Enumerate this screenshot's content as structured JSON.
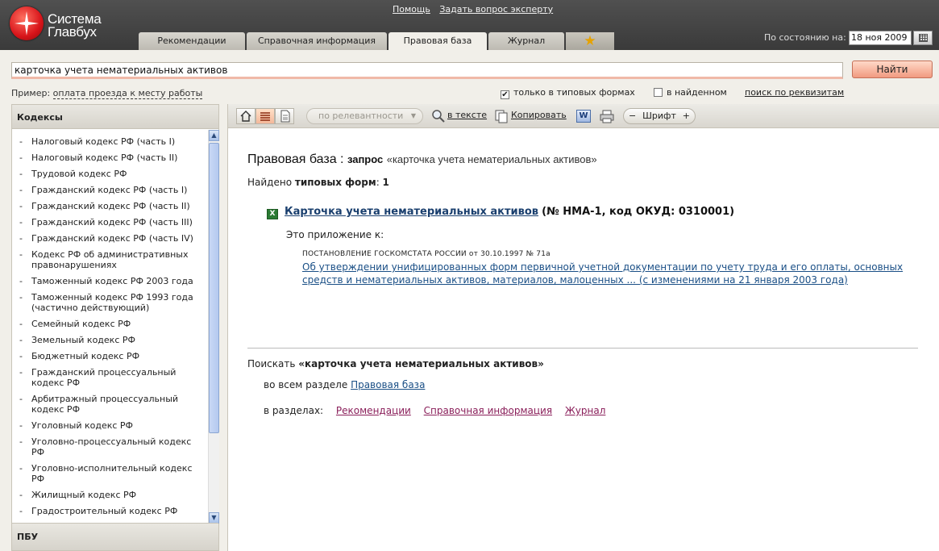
{
  "brand": {
    "line1": "Система",
    "line2": "Главбух"
  },
  "top_links": {
    "help": "Помощь",
    "ask_expert": "Задать вопрос эксперту"
  },
  "tabs": [
    {
      "label": "Рекомендации",
      "active": false
    },
    {
      "label": "Справочная информация",
      "active": false
    },
    {
      "label": "Правовая база",
      "active": true
    },
    {
      "label": "Журнал",
      "active": false
    }
  ],
  "favorites_icon": "star-icon",
  "date": {
    "label": "По состоянию на:",
    "value": "18 ноя 2009"
  },
  "search": {
    "value": "карточка учета нематериальных активов",
    "button": "Найти"
  },
  "example": {
    "label": "Пример:",
    "link": "оплата проезда к месту работы"
  },
  "filters": {
    "typical_forms": {
      "label": "только в типовых формах",
      "checked": true
    },
    "in_found": {
      "label": "в найденном",
      "checked": false
    },
    "by_requisites": "поиск по реквизитам"
  },
  "left_panel": {
    "title": "Кодексы",
    "items": [
      "Налоговый кодекс РФ (часть I)",
      "Налоговый кодекс РФ (часть II)",
      "Трудовой кодекс РФ",
      "Гражданский кодекс РФ (часть I)",
      "Гражданский кодекс РФ (часть II)",
      "Гражданский кодекс РФ (часть III)",
      "Гражданский кодекс РФ (часть IV)",
      "Кодекс РФ об административных правонарушениях",
      "Таможенный кодекс РФ 2003 года",
      "Таможенный кодекс РФ 1993 года (частично действующий)",
      "Семейный кодекс РФ",
      "Земельный кодекс РФ",
      "Бюджетный кодекс РФ",
      "Гражданский процессуальный кодекс РФ",
      "Арбитражный процессуальный кодекс РФ",
      "Уголовный кодекс РФ",
      "Уголовно-процессуальный кодекс РФ",
      "Уголовно-исполнительный кодекс РФ",
      "Жилищный кодекс РФ",
      "Градостроительный кодекс РФ"
    ],
    "footer": "ПБУ"
  },
  "toolbar": {
    "sort": "по релевантности",
    "in_text": "в тексте",
    "copy": "Копировать",
    "font": "Шрифт",
    "minus": "−",
    "plus": "+"
  },
  "result": {
    "title": "Правовая база :",
    "query_label": "запрос",
    "query": "«карточка учета нематериальных активов»",
    "found_label": "Найдено",
    "found_type": "типовых форм",
    "found_count": "1",
    "doc_title": "Карточка учета нематериальных активов",
    "doc_meta": "(№ НМА-1, код ОКУД: 0310001)",
    "appendix_to": "Это приложение к:",
    "post_header": "ПОСТАНОВЛЕНИЕ ГОСКОМСТАТА РОССИИ от 30.10.1997 № 71а",
    "post_link": "Об утверждении унифицированных форм первичной учетной документации по учету труда и его оплаты, основных средств и нематериальных активов, материалов, малоценных ... (с изменениями на 21 января 2003 года)"
  },
  "search_more": {
    "label": "Поискать",
    "query": "«карточка учета нематериальных активов»",
    "whole_label": "во всем разделе",
    "whole_link": "Правовая база",
    "sections_label": "в разделах:",
    "sections": [
      "Рекомендации",
      "Справочная информация",
      "Журнал"
    ]
  }
}
